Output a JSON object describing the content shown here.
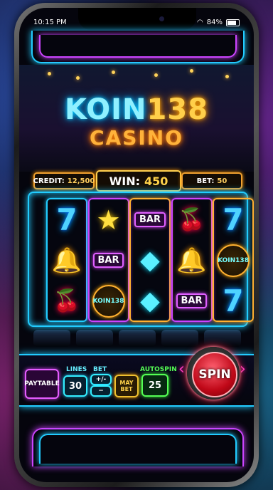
{
  "status": {
    "time": "10:15 PM",
    "battery": "84%"
  },
  "logo": {
    "koin": "KOIN",
    "num": "138",
    "casino": "CASINO"
  },
  "meters": {
    "credit_label": "CREDIT:",
    "credit_value": "12,500",
    "win_label": "WIN:",
    "win_value": "450",
    "bet_label": "BET:",
    "bet_value": "50"
  },
  "reels": [
    [
      "seven",
      "bell",
      "cherry"
    ],
    [
      "star",
      "bar",
      "koin"
    ],
    [
      "bar",
      "diamond",
      "diamond"
    ],
    [
      "cherry",
      "bell",
      "bar"
    ],
    [
      "seven",
      "koin",
      "seven"
    ]
  ],
  "symbols": {
    "seven": "7",
    "star": "★",
    "bell": "🔔",
    "cherry": "🍒",
    "diamond": "◆",
    "bar": "BAR",
    "koin": "KOIN138"
  },
  "controls": {
    "paytable": "PAYTABLE",
    "lines_label": "LINES",
    "lines_value": "30",
    "bet_label": "BET",
    "bet_plus": "+/-",
    "bet_minus": "−",
    "max_bet": "MAY BET",
    "autospin_label": "AUTOSPIN",
    "autospin_value": "25",
    "spin": "SPIN"
  },
  "colors": {
    "neon_cyan": "#22ccff",
    "neon_purple": "#cc44ff",
    "gold": "#ffcf4a"
  }
}
